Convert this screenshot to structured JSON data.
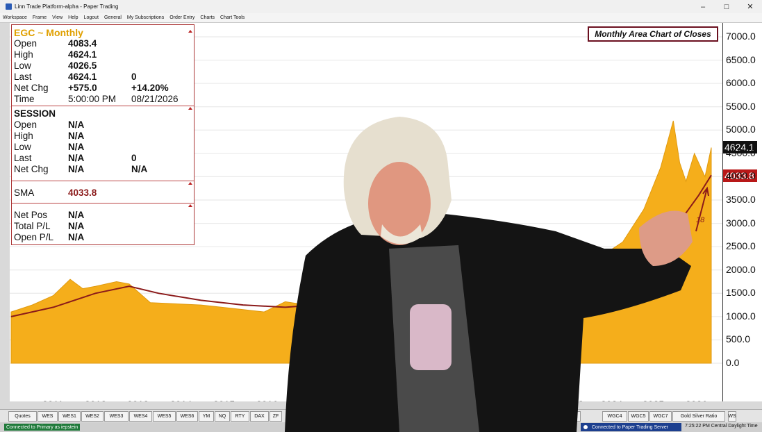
{
  "window": {
    "title": "Linn Trade Platform-alpha - Paper Trading",
    "minimize": "–",
    "maximize": "□",
    "close": "✕"
  },
  "menu": [
    "Workspace",
    "Frame",
    "View",
    "Help",
    "Logout",
    "General",
    "My Subscriptions",
    "Order Entry",
    "Charts",
    "Chart Tools"
  ],
  "chart_title": "Monthly Area Chart of Closes",
  "info": {
    "header": "EGC ~ Monthly",
    "open_label": "Open",
    "open": "4083.4",
    "high_label": "High",
    "high": "4624.1",
    "low_label": "Low",
    "low": "4026.5",
    "last_label": "Last",
    "last": "4624.1",
    "last_extra": "0",
    "netchg_label": "Net Chg",
    "netchg": "+575.0",
    "netchg_pct": "+14.20%",
    "time_label": "Time",
    "time": "5:00:00 PM",
    "date": "08/21/2026",
    "session_header": "SESSION",
    "s_open_label": "Open",
    "s_open": "N/A",
    "s_high_label": "High",
    "s_high": "N/A",
    "s_low_label": "Low",
    "s_low": "N/A",
    "s_last_label": "Last",
    "s_last": "N/A",
    "s_last_extra": "0",
    "s_netchg_label": "Net Chg",
    "s_netchg": "N/A",
    "s_netchg_extra": "N/A",
    "sma_label": "SMA",
    "sma": "4033.8",
    "netpos_label": "Net Pos",
    "netpos": "N/A",
    "totalpl_label": "Total P/L",
    "totalpl": "N/A",
    "openpl_label": "Open P/L",
    "openpl": "N/A"
  },
  "price_tags": {
    "last": "4624.1",
    "sma": "4033.8"
  },
  "annotation": "18",
  "tabs": [
    "Quotes",
    "WES",
    "WES1",
    "WES2",
    "WES3",
    "WES4",
    "WES5",
    "WES6",
    "YM",
    "NQ",
    "RTY",
    "DAX",
    "ZF",
    "WGC2",
    "WGC4",
    "WGC5",
    "WGC7",
    "Gold Silver Ratio",
    "WS"
  ],
  "status": {
    "left": "Connected to Primary as iepstein",
    "middle": "Connected to Paper Trading Server",
    "right": "7:25:22 PM Central Daylight Time"
  },
  "colors": {
    "area": "#f5ae1b",
    "sma_line": "#8b1a1a",
    "last_tag": "#111111",
    "sma_tag": "#b81818",
    "header_text": "#e0a000"
  },
  "chart_data": {
    "type": "area",
    "title": "Monthly Area Chart of Closes",
    "x": [
      "2010.0",
      "2010.5",
      "2011.0",
      "2011.4",
      "2011.7",
      "2012.0",
      "2012.5",
      "2012.8",
      "2013.3",
      "2013.8",
      "2014.5",
      "2015.0",
      "2015.5",
      "2016.0",
      "2016.5",
      "2017.0",
      "2018.0",
      "2019.0",
      "2020.0",
      "2021.0",
      "2022.0",
      "2023.0",
      "2023.5",
      "2024.0",
      "2024.5",
      "2025.0",
      "2025.4",
      "2025.7",
      "2025.85",
      "2026.0",
      "2026.2",
      "2026.45",
      "2026.6"
    ],
    "y": [
      1100,
      1250,
      1450,
      1800,
      1600,
      1650,
      1750,
      1700,
      1300,
      1280,
      1250,
      1200,
      1150,
      1100,
      1320,
      1250,
      1320,
      1400,
      1700,
      1800,
      1750,
      1950,
      2000,
      2300,
      2600,
      3300,
      4200,
      5200,
      4300,
      3900,
      4500,
      4000,
      4624.1
    ],
    "xlabel_ticks": [
      "2011",
      "2012",
      "2013",
      "2014",
      "2015",
      "2016",
      "2023",
      "2024",
      "2025",
      "2026"
    ],
    "y_ticks": [
      "7000.0",
      "6500.0",
      "6000.0",
      "5500.0",
      "5000.0",
      "4500.0",
      "4000.0",
      "3500.0",
      "3000.0",
      "2500.0",
      "2000.0",
      "1500.0",
      "1000.0",
      "500.0",
      "0.0"
    ],
    "ylim": [
      0,
      7000
    ],
    "sma": {
      "name": "SMA",
      "x": [
        "2010.0",
        "2011.0",
        "2012.0",
        "2012.8",
        "2013.5",
        "2014.5",
        "2015.5",
        "2016.5",
        "2018.0",
        "2020.0",
        "2022.0",
        "2023.5",
        "2024.5",
        "2025.3",
        "2025.9",
        "2026.3",
        "2026.6"
      ],
      "y": [
        1000,
        1200,
        1500,
        1650,
        1500,
        1350,
        1250,
        1200,
        1300,
        1500,
        1650,
        1800,
        2100,
        2600,
        3100,
        3600,
        4033.8
      ]
    },
    "grid": true
  }
}
